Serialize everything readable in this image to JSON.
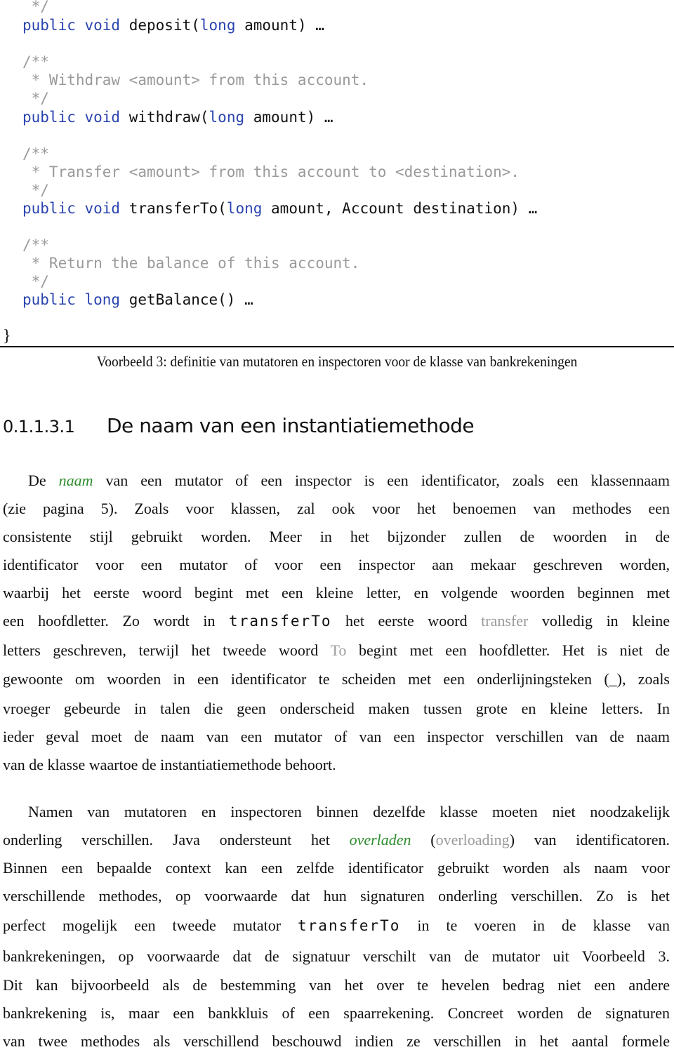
{
  "code": {
    "lines": [
      {
        "type": "comment",
        "text": " */"
      },
      {
        "type": "signature",
        "mods": "public void",
        "name": "deposit(",
        "ptype": "long",
        "rest": " amount) …"
      },
      {
        "type": "comment",
        "text": "/**"
      },
      {
        "type": "comment",
        "text": " * Withdraw <amount> from this account."
      },
      {
        "type": "comment",
        "text": " */"
      },
      {
        "type": "signature",
        "mods": "public void",
        "name": "withdraw(",
        "ptype": "long",
        "rest": " amount) …"
      },
      {
        "type": "comment",
        "text": "/**"
      },
      {
        "type": "comment",
        "text": " * Transfer <amount> from this account to <destination>."
      },
      {
        "type": "comment",
        "text": " */"
      },
      {
        "type": "signature",
        "mods": "public void",
        "name": "transferTo(",
        "ptype": "long",
        "rest": " amount, Account destination) …"
      },
      {
        "type": "comment",
        "text": "/**"
      },
      {
        "type": "comment",
        "text": " * Return the balance of this account."
      },
      {
        "type": "comment",
        "text": " */"
      },
      {
        "type": "signature",
        "mods": "public long",
        "name": "getBalance() …",
        "ptype": "",
        "rest": ""
      },
      {
        "type": "brace",
        "text": "}"
      }
    ]
  },
  "caption": "Voorbeeld 3: definitie van mutatoren en inspectoren voor de klasse van bankrekeningen",
  "section": {
    "number": "0.1.1.3.1",
    "title": "De naam van een instantiatiemethode"
  },
  "paragraph1": {
    "l1": {
      "a": "De ",
      "term": "naam",
      "b": " van een mutator of een inspector is een identificator, zoals een klassennaam"
    },
    "l2": "(zie pagina 5). Zoals voor klassen, zal ook voor het benoemen van methodes een",
    "l3": "consistente stijl gebruikt worden. Meer in het bijzonder zullen de woorden in de",
    "l4": "identificator voor een mutator of voor een inspector aan mekaar geschreven worden,",
    "l5": "waarbij het eerste woord begint met een kleine letter, en volgende woorden beginnen met",
    "l6": {
      "a": "een hoofdletter. Zo wordt in ",
      "code": "transferTo",
      "b": " het eerste woord ",
      "grey": "transfer",
      "c": " volledig in kleine"
    },
    "l7": {
      "a": "letters geschreven, terwijl het tweede woord ",
      "grey": "To",
      "b": " begint met een hoofdletter. Het is niet de"
    },
    "l8": "gewoonte om woorden in een identificator te scheiden met een onderlijningsteken (_), zoals",
    "l9": "vroeger gebeurde in talen die geen onderscheid maken tussen grote en kleine letters. In",
    "l10": "ieder geval moet de naam van een mutator of van een inspector verschillen van de naam",
    "l11": "van de klasse waartoe de instantiatiemethode behoort."
  },
  "paragraph2": {
    "l1": "Namen van mutatoren en inspectoren binnen dezelfde klasse moeten niet noodzakelijk",
    "l2": {
      "a": "onderling verschillen. Java ondersteunt het ",
      "term": "overladen",
      "b": " (",
      "grey": "overloading",
      "c": ") van identificatoren."
    },
    "l3": "Binnen een bepaalde context kan een zelfde identificator gebruikt worden als naam voor",
    "l4": "verschillende methodes, op voorwaarde dat hun signaturen onderling verschillen. Zo is het",
    "l5": {
      "a": "perfect mogelijk een tweede mutator ",
      "code": "transferTo",
      "b": " in te voeren in de klasse van"
    },
    "l6": "bankrekeningen, op voorwaarde dat de signatuur verschilt van de mutator uit Voorbeeld 3.",
    "l7": "Dit kan bijvoorbeeld als de bestemming van het over te hevelen bedrag niet een andere",
    "l8": "bankrekening is, maar een bankkluis of een spaarrekening. Concreet worden de signaturen",
    "l9": "van twee methodes als verschillend beschouwd indien ze verschillen in het aantal formele"
  },
  "colors": {
    "keyword": "#2a44b0",
    "comment": "#9a9a9a",
    "term": "#2e8b2e",
    "translation": "#9a9a9a"
  }
}
